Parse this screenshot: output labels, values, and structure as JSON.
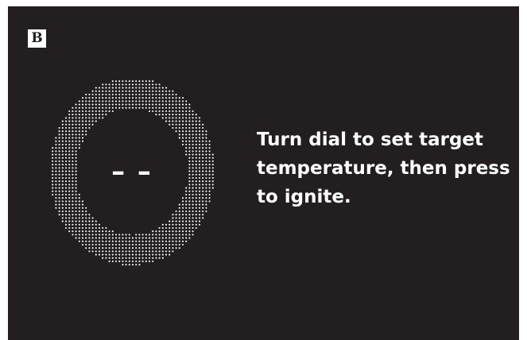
{
  "panel": {
    "label": "B"
  },
  "dial": {
    "icon": "dotted-ring-dial",
    "readout": "– –"
  },
  "instruction": {
    "text": "Turn dial to set target temperature, then press to ignite."
  },
  "colors": {
    "screen_background": "#231f20",
    "foreground": "#ffffff"
  }
}
